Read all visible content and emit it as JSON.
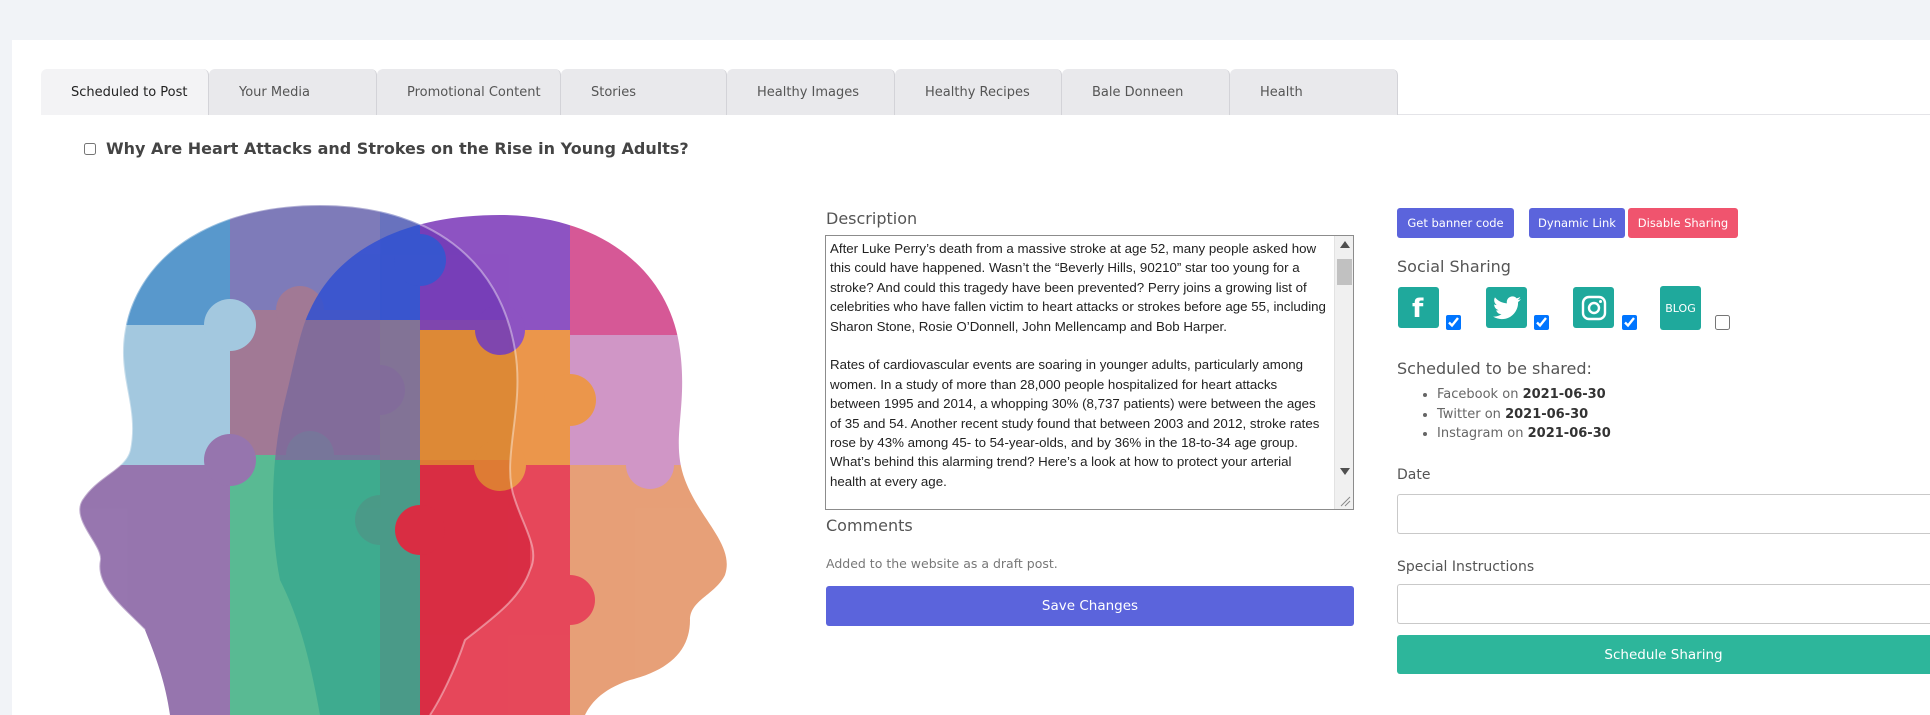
{
  "tabs": [
    {
      "label": "Scheduled to Post",
      "active": true
    },
    {
      "label": "Your Media"
    },
    {
      "label": "Promotional Content"
    },
    {
      "label": "Stories"
    },
    {
      "label": "Healthy Images"
    },
    {
      "label": "Healthy Recipes"
    },
    {
      "label": "Bale Donneen"
    },
    {
      "label": "Health"
    }
  ],
  "post": {
    "title": "Why Are Heart Attacks and Strokes on the Rise in Young Adults?",
    "description_label": "Description",
    "description": "After Luke Perry’s death from a massive stroke at age 52, many people asked how this could have happened. Wasn’t the “Beverly Hills, 90210” star too young for a stroke? And could this tragedy have been prevented? Perry joins a growing list of celebrities who have fallen victim to heart attacks or strokes before age 55, including Sharon Stone, Rosie O’Donnell, John Mellencamp and Bob Harper.\n\nRates of cardiovascular events are soaring in younger adults, particularly among women. In a study of more than 28,000 people hospitalized for heart attacks between 1995 and 2014, a whopping 30% (8,737 patients) were between the ages of 35 and 54. Another recent study found that between 2003 and 2012, stroke rates rose by 43% among 45- to 54-year-olds, and by 36% in the 18-to-34 age group. What’s behind this alarming trend? Here’s a look at how to protect your arterial health at every age.",
    "comments_label": "Comments",
    "comments_note": "Added to the website as a draft post.",
    "save_label": "Save Changes"
  },
  "actions": {
    "banner_label": "Get banner code",
    "dynamic_label": "Dynamic Link",
    "disable_label": "Disable Sharing"
  },
  "social": {
    "heading": "Social Sharing",
    "blog_label": "BLOG",
    "facebook_checked": true,
    "twitter_checked": true,
    "instagram_checked": true,
    "blog_checked": false
  },
  "scheduled": {
    "heading": "Scheduled to be shared:",
    "on": "on",
    "items": [
      {
        "network": "Facebook",
        "date": "2021-06-30"
      },
      {
        "network": "Twitter",
        "date": "2021-06-30"
      },
      {
        "network": "Instagram",
        "date": "2021-06-30"
      }
    ]
  },
  "form": {
    "date_label": "Date",
    "date_value": "",
    "instructions_label": "Special Instructions",
    "instructions_value": "",
    "schedule_label": "Schedule Sharing"
  },
  "colors": {
    "primary": "#5b64dc",
    "danger": "#f0546e",
    "social": "#1fa99c",
    "schedule": "#2db69b"
  }
}
